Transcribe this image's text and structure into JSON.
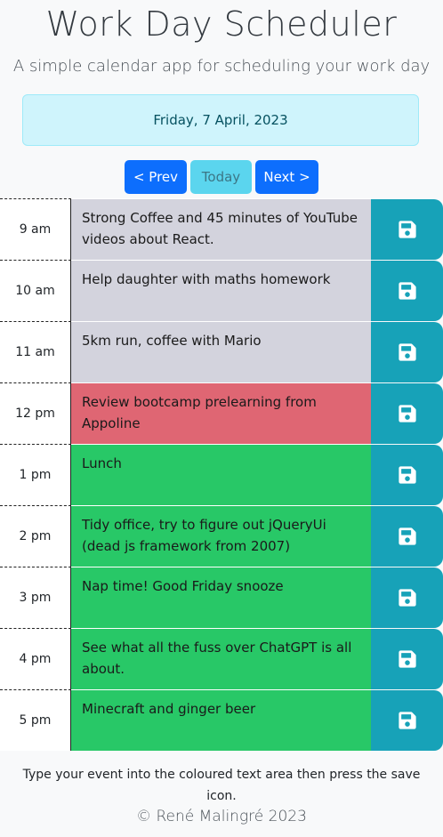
{
  "header": {
    "title": "Work Day Scheduler",
    "subtitle": "A simple calendar app for scheduling your work day"
  },
  "current_date": "Friday, 7 April, 2023",
  "nav": {
    "prev_label": "< Prev",
    "today_label": "Today",
    "next_label": "Next >"
  },
  "colors": {
    "past": "#d3d3dd",
    "present": "#df6673",
    "future": "#28c867",
    "save": "#17a2b8"
  },
  "hours": [
    {
      "hour": "9 am",
      "text": "Strong Coffee and 45 minutes of YouTube videos about React.",
      "status": "past"
    },
    {
      "hour": "10 am",
      "text": "Help daughter with maths homework",
      "status": "past"
    },
    {
      "hour": "11 am",
      "text": "5km run, coffee with Mario",
      "status": "past"
    },
    {
      "hour": "12 pm",
      "text": "Review bootcamp prelearning from Appoline",
      "status": "present"
    },
    {
      "hour": "1 pm",
      "text": "Lunch",
      "status": "future"
    },
    {
      "hour": "2 pm",
      "text": "Tidy office, try to figure out jQueryUi (dead js framework from 2007)",
      "status": "future"
    },
    {
      "hour": "3 pm",
      "text": "Nap time! Good Friday snooze",
      "status": "future"
    },
    {
      "hour": "4 pm",
      "text": "See what all the fuss over ChatGPT is all about.",
      "status": "future"
    },
    {
      "hour": "5 pm",
      "text": "Minecraft and ginger beer",
      "status": "future"
    }
  ],
  "save_icon": "floppy-disk-icon",
  "footer": {
    "instructions": "Type your event into the coloured text area then press the save icon.",
    "copyright": "© René Malingré 2023"
  }
}
